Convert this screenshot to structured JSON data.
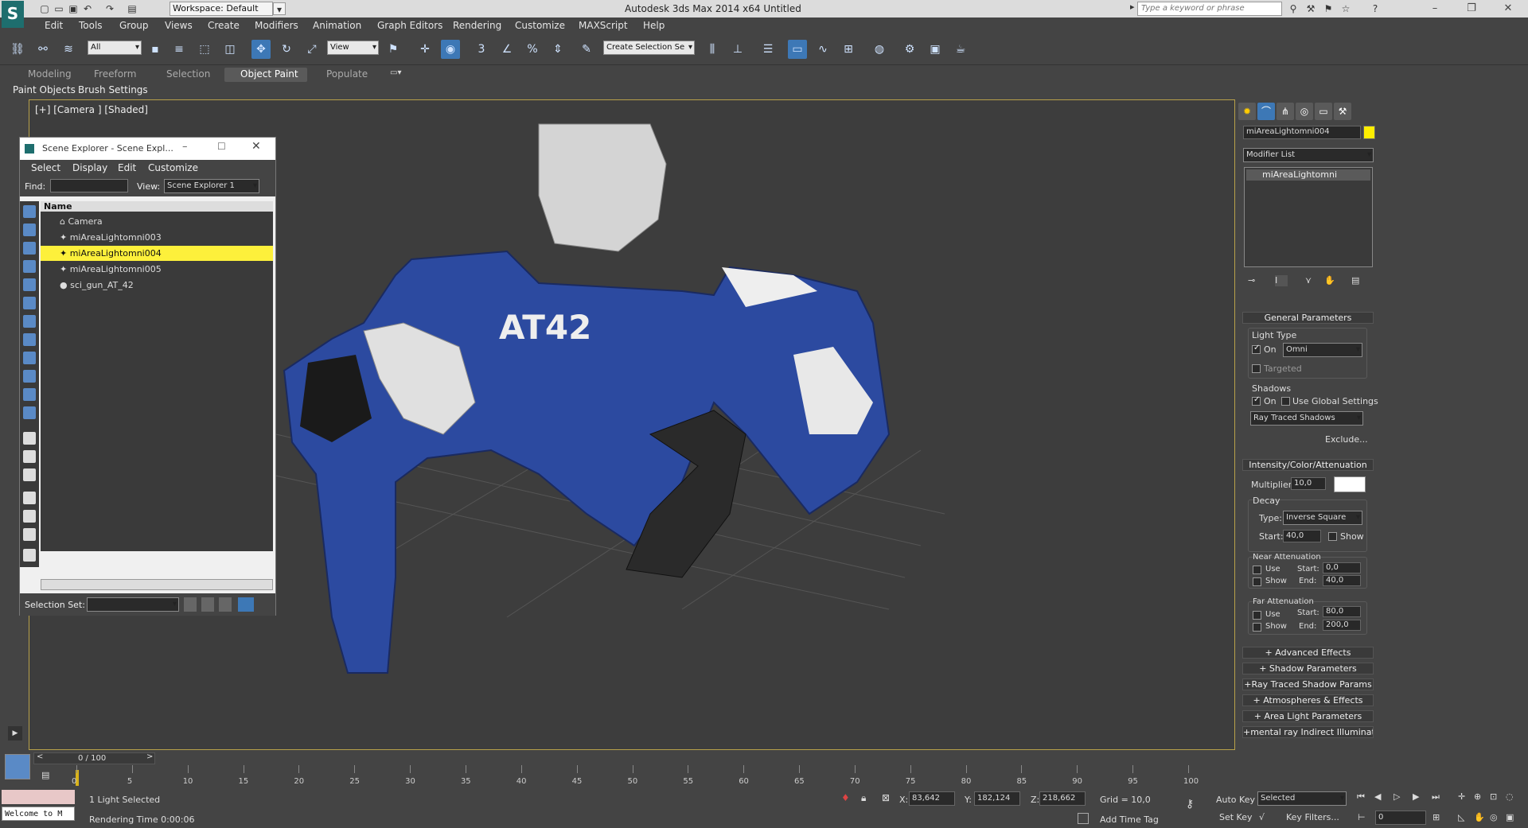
{
  "app": {
    "title": "Autodesk 3ds Max  2014 x64     Untitled",
    "workspace": "Workspace: Default",
    "search_placeholder": "Type a keyword or phrase"
  },
  "menu": [
    "Edit",
    "Tools",
    "Group",
    "Views",
    "Create",
    "Modifiers",
    "Animation",
    "Graph Editors",
    "Rendering",
    "Customize",
    "MAXScript",
    "Help"
  ],
  "toolbar": {
    "filter": "All",
    "refcoord": "View",
    "selset": "Create Selection Se"
  },
  "ribbon": {
    "tabs": [
      "Modeling",
      "Freeform",
      "Selection",
      "Object Paint",
      "Populate"
    ],
    "active": "Object Paint",
    "sub": [
      "Paint Objects",
      "Brush Settings"
    ]
  },
  "viewport": {
    "label": "[+] [Camera ] [Shaded]",
    "model_label": "AT42"
  },
  "explorer": {
    "title": "Scene Explorer - Scene Expl...",
    "menu": [
      "Select",
      "Display",
      "Edit",
      "Customize"
    ],
    "find_label": "Find:",
    "view_label": "View:",
    "view_value": "Scene Explorer 1",
    "col_name": "Name",
    "rows": [
      {
        "name": "Camera"
      },
      {
        "name": "miAreaLightomni003"
      },
      {
        "name": "miAreaLightomni004",
        "selected": true
      },
      {
        "name": "miAreaLightomni005"
      },
      {
        "name": "sci_gun_AT_42"
      }
    ],
    "selection_set_label": "Selection Set:"
  },
  "cmd": {
    "object_name": "miAreaLightomni004",
    "object_color": "#ffee00",
    "modifier_list": "Modifier List",
    "stack_item": "miAreaLightomni",
    "general": {
      "title": "General Parameters",
      "light_type": "Light Type",
      "on": "On",
      "type": "Omni",
      "targeted": "Targeted",
      "shadows": "Shadows",
      "use_global": "Use Global Settings",
      "shadow_type": "Ray Traced Shadows",
      "exclude": "Exclude..."
    },
    "intensity": {
      "title": "Intensity/Color/Attenuation",
      "multiplier_label": "Multiplier:",
      "multiplier": "10,0",
      "decay": "Decay",
      "type_label": "Type:",
      "decay_type": "Inverse Square",
      "start_label": "Start:",
      "start": "40,0",
      "show": "Show",
      "near": "Near Attenuation",
      "use": "Use",
      "near_start": "0,0",
      "near_end": "40,0",
      "far": "Far Attenuation",
      "far_start": "80,0",
      "far_end": "200,0",
      "start_s": "Start:",
      "end_s": "End:"
    },
    "rollouts": [
      "Advanced Effects",
      "Shadow Parameters",
      "Ray Traced Shadow Params",
      "Atmospheres & Effects",
      "Area Light Parameters",
      "mental ray Indirect Illumination"
    ]
  },
  "timeline": {
    "frame": "0 / 100",
    "ticks": [
      "0",
      "5",
      "10",
      "15",
      "20",
      "25",
      "30",
      "35",
      "40",
      "45",
      "50",
      "55",
      "60",
      "65",
      "70",
      "75",
      "80",
      "85",
      "90",
      "95",
      "100"
    ]
  },
  "status": {
    "listener": "Welcome to M",
    "selected": "1 Light Selected",
    "render_time": "Rendering Time 0:00:06",
    "x": "83,642",
    "y": "182,124",
    "z": "218,662",
    "grid": "Grid = 10,0",
    "add_time_tag": "Add Time Tag",
    "auto_key": "Auto Key",
    "set_key": "Set Key",
    "key_mode": "Selected",
    "key_filters": "Key Filters...",
    "current_frame": "0"
  }
}
